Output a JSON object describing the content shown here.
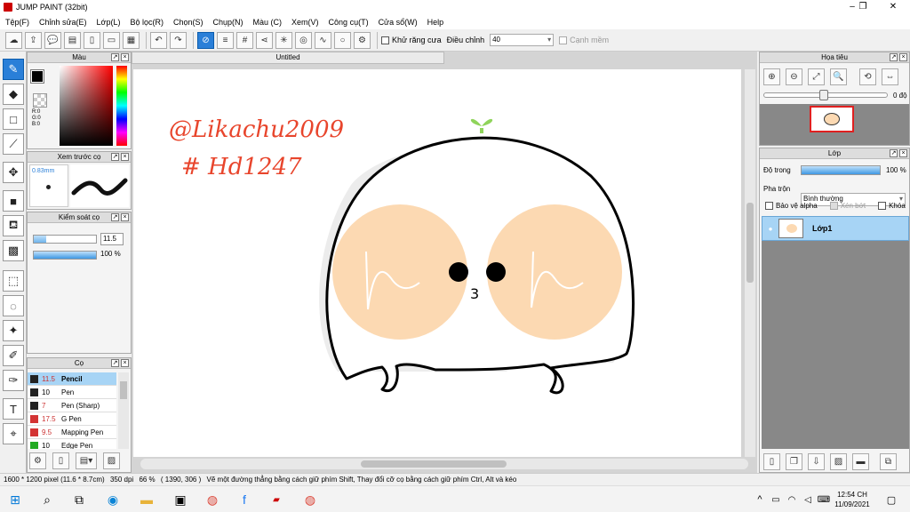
{
  "window": {
    "title": "JUMP PAINT (32bit)",
    "minimize": "–",
    "restore": "❐",
    "close": "✕"
  },
  "menu": [
    "Tệp(F)",
    "Chỉnh sửa(E)",
    "Lớp(L)",
    "Bộ lọc(R)",
    "Chọn(S)",
    "Chụp(N)",
    "Màu (C)",
    "Xem(V)",
    "Công cụ(T)",
    "Cửa sổ(W)",
    "Help"
  ],
  "toolbar": {
    "antialias_label": "Khử răng cưa",
    "adjust_label": "Điều chỉnh",
    "adjust_value": "40",
    "edge_label": "Cạnh mềm"
  },
  "document": {
    "tab_title": "Untitled"
  },
  "panels": {
    "color": {
      "title": "Màu",
      "r": "R:0",
      "g": "G:0",
      "b": "B:0"
    },
    "preview": {
      "title": "Xem trước cọ",
      "size": "0.83mm"
    },
    "brush_control": {
      "title": "Kiểm soát cọ",
      "size_value": "11.5",
      "opacity_value": "100 %"
    },
    "brushes": {
      "title": "Cọ",
      "items": [
        {
          "size": "11.5",
          "name": "Pencil",
          "color": "#222222"
        },
        {
          "size": "10",
          "name": "Pen",
          "color": "#222222"
        },
        {
          "size": "7",
          "name": "Pen (Sharp)",
          "color": "#222222"
        },
        {
          "size": "17.5",
          "name": "G Pen",
          "color": "#d33333"
        },
        {
          "size": "9.5",
          "name": "Mapping Pen",
          "color": "#d33333"
        },
        {
          "size": "10",
          "name": "Edge Pen",
          "color": "#22aa22"
        }
      ]
    },
    "navigator": {
      "title": "Họa tiêu",
      "rotation": "0 độ"
    },
    "layers": {
      "title": "Lớp",
      "opacity_label": "Độ trong",
      "opacity_value": "100 %",
      "blend_label": "Pha trộn",
      "blend_value": "Bình thường",
      "protect_alpha": "Bảo vệ alpha",
      "clip": "Xén bớt",
      "lock": "Khóa",
      "layer_name": "Lớp1"
    }
  },
  "artwork": {
    "signature_line1": "@Likachu2009",
    "signature_line2": "# Hd1247",
    "mouth": "3"
  },
  "statusbar": {
    "size": "1600 * 1200 pixel",
    "physical": "(11.6 * 8.7cm)",
    "dpi": "350 dpi",
    "zoom": "66 %",
    "coords": "( 1390, 306 )",
    "hint": "Vẽ một đường thẳng bằng cách giữ phím Shift, Thay đổi cỡ cọ bằng cách giữ phím Ctrl, Alt và kéo"
  },
  "taskbar": {
    "time": "12:54 CH",
    "date": "11/09/2021"
  },
  "colors": {
    "accent": "#2a7fd8",
    "layer_selected": "#a7d4f5",
    "signature": "#e8452c",
    "cheek": "#fcd9b2",
    "sprout": "#8fd45a"
  }
}
